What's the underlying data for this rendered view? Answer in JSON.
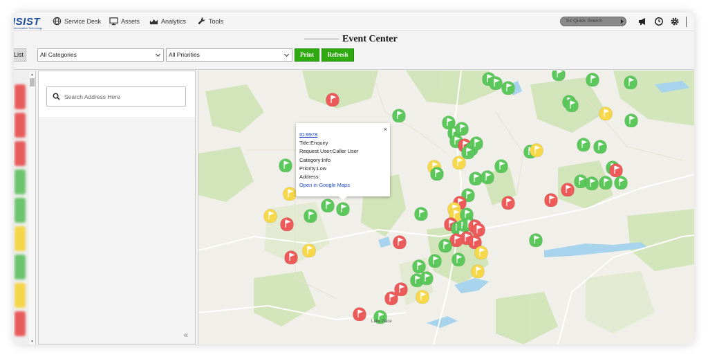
{
  "app": {
    "logo_text": "ISIST",
    "logo_sub": "Information Technology"
  },
  "nav": {
    "items": [
      {
        "label": "Service Desk",
        "icon": "globe-icon"
      },
      {
        "label": "Assets",
        "icon": "monitor-icon"
      },
      {
        "label": "Analytics",
        "icon": "chart-icon"
      },
      {
        "label": "Tools",
        "icon": "wrench-icon"
      }
    ],
    "quick_search_placeholder": "Ez Quick Search",
    "right_icons": [
      "megaphone-icon",
      "clock-icon",
      "gear-icon"
    ]
  },
  "toolbar": {
    "page_title": "Event Center",
    "list_label": "List",
    "category_value": "All Categories",
    "priority_value": "All Priorities",
    "print_label": "Print",
    "refresh_label": "Refresh"
  },
  "side_panel": {
    "search_placeholder": "Search Address Here",
    "collapse_label": "«"
  },
  "popup": {
    "id": "ID:9978",
    "title": "Title:Enquiry",
    "request_user": "Request User:Caller User",
    "category": "Category:Info",
    "priority": "Priority:Low",
    "address": "Address:",
    "link": "Open in Google Maps",
    "close": "×"
  },
  "map": {
    "colors": {
      "green": "#5cc85c",
      "red": "#ec5a5a",
      "yellow": "#f6d84a"
    },
    "city_label": "Lake Place"
  },
  "left_strip_colors": [
    "#e85c5c",
    "#e85c5c",
    "#e85c5c",
    "#6cc46c",
    "#6cc46c",
    "#f4d64c",
    "#6cc46c",
    "#f4d64c",
    "#e85c5c"
  ]
}
